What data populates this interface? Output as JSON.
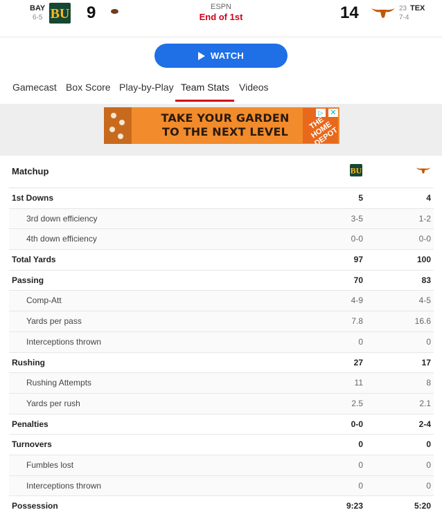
{
  "scoreboard": {
    "away": {
      "abbr": "BAY",
      "record": "6-5",
      "score": "9"
    },
    "home": {
      "abbr": "TEX",
      "rank": "23",
      "record": "7-4",
      "score": "14"
    },
    "network": "ESPN",
    "status": "End of 1st"
  },
  "watch": {
    "label": "WATCH"
  },
  "tabs": [
    "Gamecast",
    "Box Score",
    "Play-by-Play",
    "Team Stats",
    "Videos"
  ],
  "active_tab": "Team Stats",
  "ad": {
    "line1": "TAKE YOUR GARDEN",
    "line2": "TO THE NEXT LEVEL",
    "brand": "THE HOME DEPOT"
  },
  "matchup": {
    "title": "Matchup"
  },
  "stats": [
    {
      "label": "1st Downs",
      "bay": "5",
      "tex": "4",
      "kind": "main"
    },
    {
      "label": "3rd down efficiency",
      "bay": "3-5",
      "tex": "1-2",
      "kind": "sub"
    },
    {
      "label": "4th down efficiency",
      "bay": "0-0",
      "tex": "0-0",
      "kind": "sub"
    },
    {
      "label": "Total Yards",
      "bay": "97",
      "tex": "100",
      "kind": "main"
    },
    {
      "label": "Passing",
      "bay": "70",
      "tex": "83",
      "kind": "main"
    },
    {
      "label": "Comp-Att",
      "bay": "4-9",
      "tex": "4-5",
      "kind": "sub"
    },
    {
      "label": "Yards per pass",
      "bay": "7.8",
      "tex": "16.6",
      "kind": "sub"
    },
    {
      "label": "Interceptions thrown",
      "bay": "0",
      "tex": "0",
      "kind": "sub"
    },
    {
      "label": "Rushing",
      "bay": "27",
      "tex": "17",
      "kind": "main"
    },
    {
      "label": "Rushing Attempts",
      "bay": "11",
      "tex": "8",
      "kind": "sub"
    },
    {
      "label": "Yards per rush",
      "bay": "2.5",
      "tex": "2.1",
      "kind": "sub"
    },
    {
      "label": "Penalties",
      "bay": "0-0",
      "tex": "2-4",
      "kind": "main"
    },
    {
      "label": "Turnovers",
      "bay": "0",
      "tex": "0",
      "kind": "main"
    },
    {
      "label": "Fumbles lost",
      "bay": "0",
      "tex": "0",
      "kind": "sub"
    },
    {
      "label": "Interceptions thrown",
      "bay": "0",
      "tex": "0",
      "kind": "sub"
    },
    {
      "label": "Possession",
      "bay": "9:23",
      "tex": "5:20",
      "kind": "main"
    }
  ],
  "colors": {
    "accent": "#d0021b",
    "watch": "#1f6fe6",
    "baylor": "#154734",
    "texas": "#bf5700"
  }
}
